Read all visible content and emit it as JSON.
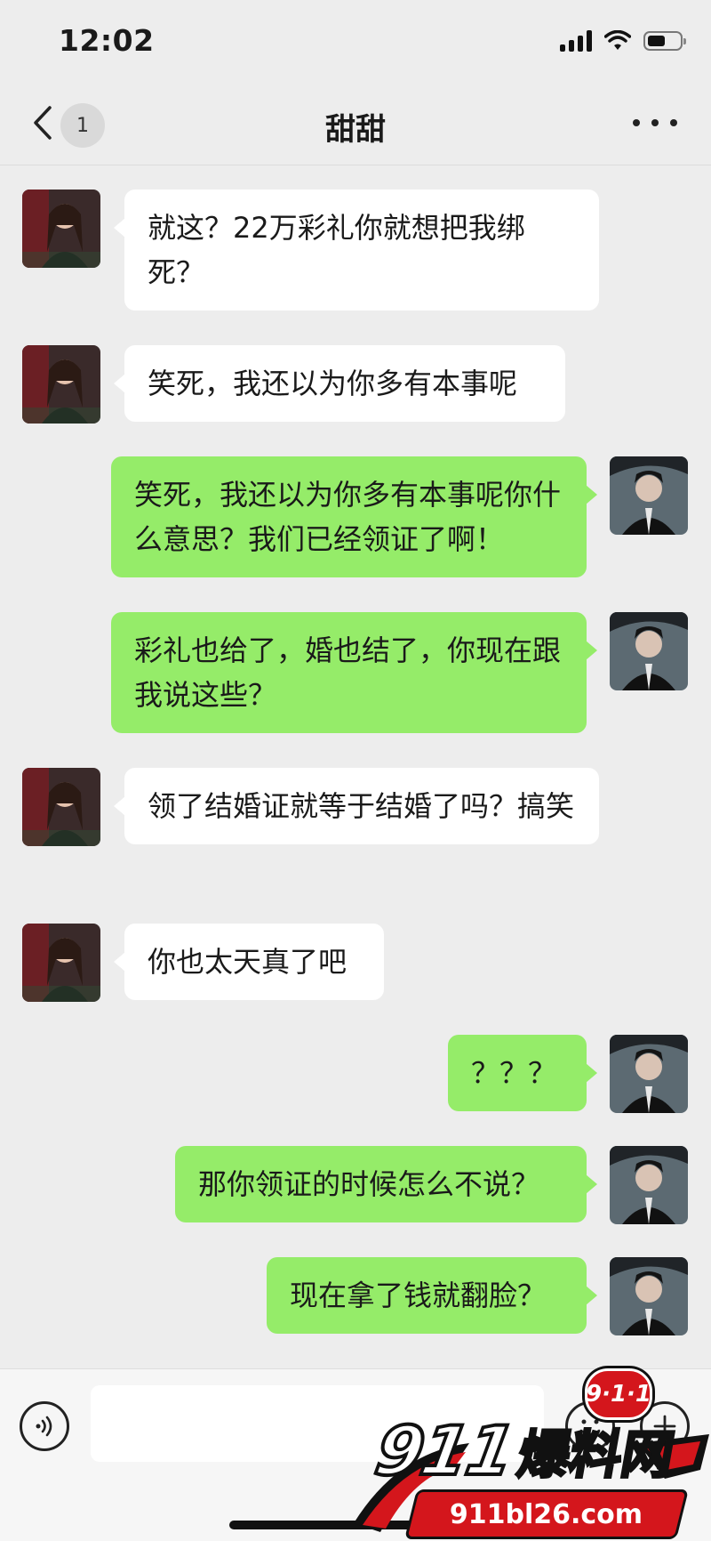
{
  "status_bar": {
    "time": "12:02",
    "battery_level": 0.55
  },
  "nav": {
    "unread_count": "1",
    "title": "甜甜"
  },
  "messages": [
    {
      "side": "in",
      "text": "就这？22万彩礼你就想把我绑死？"
    },
    {
      "side": "in",
      "text": "笑死，我还以为你多有本事呢"
    },
    {
      "side": "out",
      "text": "笑死，我还以为你多有本事呢你什么意思？我们已经领证了啊！"
    },
    {
      "side": "out",
      "text": "彩礼也给了，婚也结了，你现在跟我说这些？"
    },
    {
      "side": "in",
      "text": "领了结婚证就等于结婚了吗？搞笑"
    },
    {
      "side": "in",
      "text": "你也太天真了吧"
    },
    {
      "side": "out",
      "text": "？？？"
    },
    {
      "side": "out",
      "text": "那你领证的时候怎么不说？"
    },
    {
      "side": "out",
      "text": "现在拿了钱就翻脸？"
    }
  ],
  "input": {
    "value": ""
  },
  "icons": {
    "back": "chevron-left-icon",
    "more": "ellipsis-icon",
    "voice": "voice-icon",
    "emoji": "emoji-icon",
    "plus": "plus-icon"
  },
  "watermark": {
    "badge": "9·1·1",
    "number": "911",
    "name": "爆料网",
    "url": "911bl26.com"
  },
  "colors": {
    "bubble_out": "#95ec69",
    "bubble_in": "#ffffff",
    "background": "#ededed",
    "watermark_red": "#d4161c"
  }
}
